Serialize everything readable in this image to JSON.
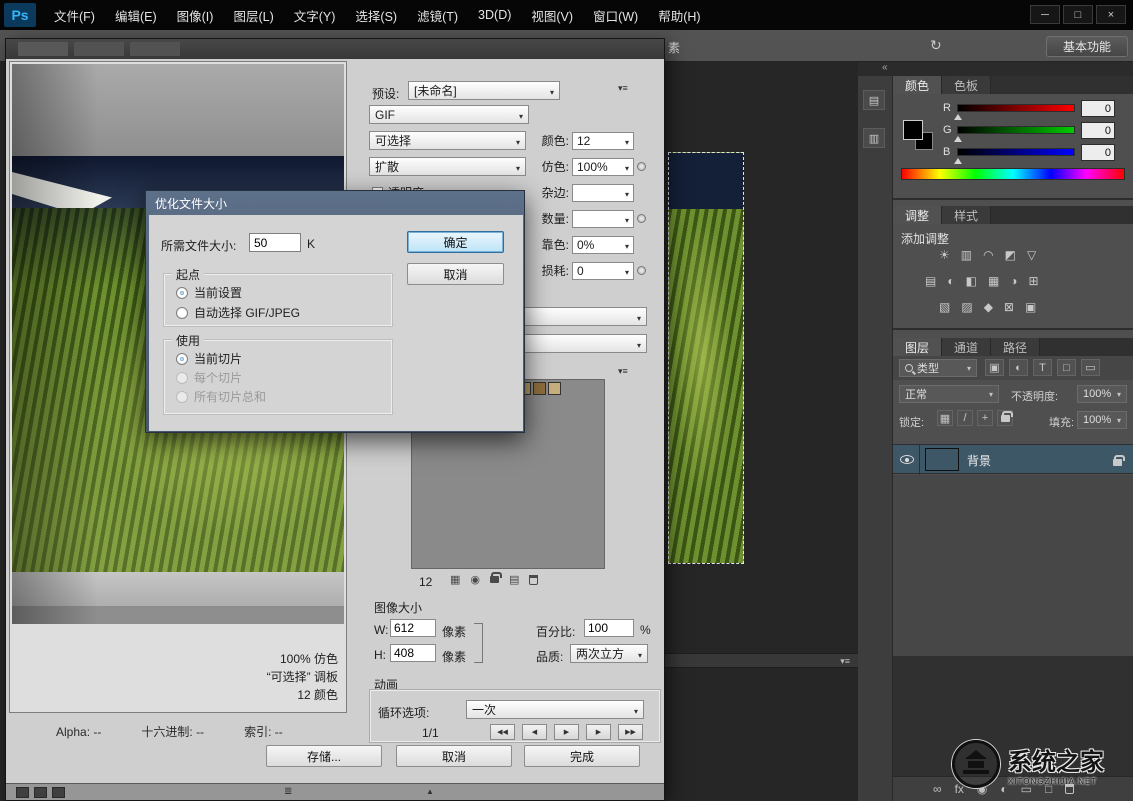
{
  "colors": {
    "accent_blue": "#2f76ad",
    "selected_layer_highlight": "#3d5766",
    "ps_logo_blue": "#35b5f5"
  },
  "titlebar": {
    "logo": "Ps",
    "menus": [
      "文件(F)",
      "编辑(E)",
      "图像(I)",
      "图层(L)",
      "文字(Y)",
      "选择(S)",
      "滤镜(T)",
      "3D(D)",
      "视图(V)",
      "窗口(W)",
      "帮助(H)"
    ],
    "min": "─",
    "max": "□",
    "close": "×"
  },
  "options_bar": {
    "fragment": "素",
    "workspace": "基本功能"
  },
  "sfw": {
    "preset_label": "预设:",
    "preset_value": "[未命名]",
    "format": "GIF",
    "palette": "可选择",
    "dither_method": "扩散",
    "transparency": "透明度",
    "rows": [
      {
        "label": "颜色:",
        "value": "12"
      },
      {
        "label": "仿色:",
        "value": "100%"
      },
      {
        "label": "杂边:",
        "value": ""
      },
      {
        "label": "数量:",
        "value": ""
      },
      {
        "label": "靠色:",
        "value": "0%"
      },
      {
        "label": "损耗:",
        "value": "0"
      }
    ],
    "color_table_count": "12",
    "image_size": {
      "title": "图像大小",
      "w_label": "W:",
      "w": "612",
      "h_label": "H:",
      "h": "408",
      "px": "像素",
      "percent_label": "百分比:",
      "percent": "100",
      "percent_unit": "%",
      "quality_label": "品质:",
      "quality": "两次立方"
    },
    "animation": {
      "title": "动画",
      "loop_label": "循环选项:",
      "loop": "一次",
      "frame": "1/1"
    },
    "preview_info": [
      "100% 仿色",
      "“可选择” 调板",
      "12 颜色"
    ],
    "status": [
      {
        "label": "Alpha:",
        "value": "--"
      },
      {
        "label": "十六进制:",
        "value": "--"
      },
      {
        "label": "索引:",
        "value": "--"
      }
    ],
    "buttons": {
      "save": "存储...",
      "cancel": "取消",
      "done": "完成"
    }
  },
  "dialog": {
    "title": "优化文件大小",
    "size_label": "所需文件大小:",
    "size_value": "50",
    "size_unit": "K",
    "ok": "确定",
    "cancel": "取消",
    "start": {
      "title": "起点",
      "current": "当前设置",
      "auto": "自动选择 GIF/JPEG"
    },
    "use": {
      "title": "使用",
      "current_slice": "当前切片",
      "each_slice": "每个切片",
      "total_slices": "所有切片总和"
    }
  },
  "panels": {
    "color": {
      "tabs": [
        "颜色",
        "色板"
      ],
      "r": {
        "label": "R",
        "value": "0"
      },
      "g": {
        "label": "G",
        "value": "0"
      },
      "b": {
        "label": "B",
        "value": "0"
      }
    },
    "adjustments": {
      "tabs": [
        "调整",
        "样式"
      ],
      "add": "添加调整"
    },
    "layers": {
      "tabs": [
        "图层",
        "通道",
        "路径"
      ],
      "filter": "类型",
      "blend": "正常",
      "opacity_label": "不透明度:",
      "opacity": "100%",
      "lock_label": "锁定:",
      "fill_label": "填充:",
      "fill": "100%",
      "name": "背景",
      "fx": "fx"
    }
  },
  "watermark": {
    "title": "系统之家",
    "sub": "XITONGZHIJIA.NET"
  },
  "glyphs": {
    "refresh": "↻",
    "collapse_left": "«",
    "panel_menu": "▾≡",
    "nav": [
      "◀◀",
      "◀",
      "▶",
      "▶",
      "▶▶"
    ],
    "adj": [
      "☀",
      "▥",
      "◠",
      "◩",
      "▽",
      "▤",
      "◐",
      "◧",
      "▦",
      "◑",
      "⊞",
      "▧",
      "▨",
      "◆",
      "⊠",
      "▣"
    ],
    "filter_icons": [
      "▣",
      "◐",
      "T",
      "□",
      "▭"
    ],
    "lock_icons": [
      "▦",
      "/",
      "+"
    ],
    "bottom_icons": [
      "∞",
      "◉",
      "◐",
      "▭",
      "□"
    ],
    "table_icons": [
      "▦",
      "◉",
      "▤"
    ],
    "strip_icons": [
      "▤",
      "▥"
    ]
  }
}
